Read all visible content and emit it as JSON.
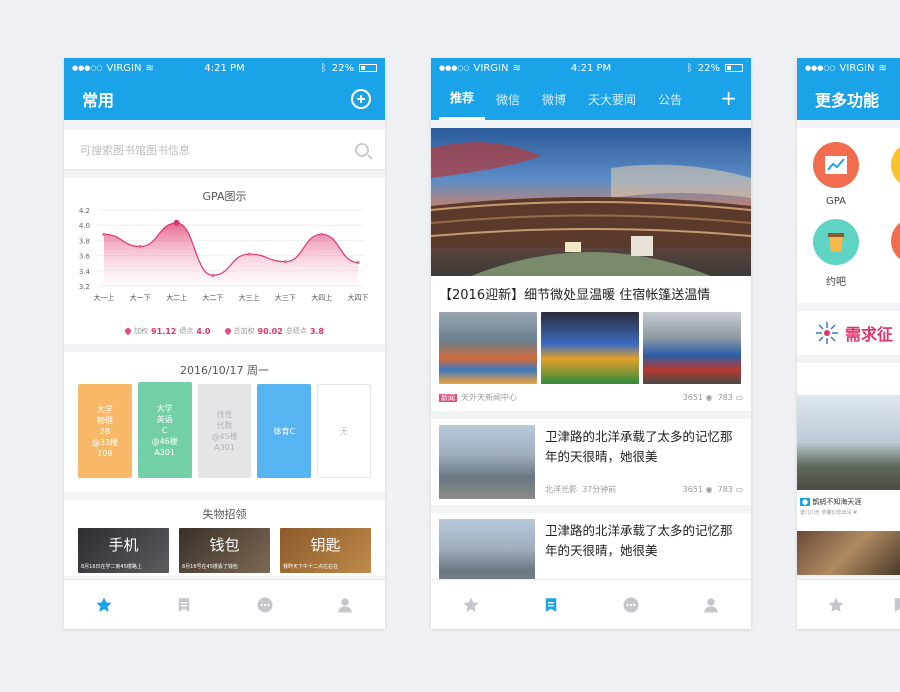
{
  "status": {
    "carrier": "VIRGIN",
    "time": "4:21 PM",
    "battery": "22%"
  },
  "screen1": {
    "title": "常用",
    "search_placeholder": "可搜索图书馆图书信息",
    "gpa": {
      "title": "GPA图示",
      "legend": [
        {
          "label": "加权",
          "value": "91.12"
        },
        {
          "label": "绩点",
          "value": "4.0"
        },
        {
          "label": "总加权",
          "value": "90.02"
        },
        {
          "label": "总绩点",
          "value": "3.8"
        }
      ]
    },
    "chart_data": {
      "type": "area",
      "title": "GPA图示",
      "categories": [
        "大一上",
        "大一下",
        "大二上",
        "大二下",
        "大三上",
        "大三下",
        "大四上",
        "大四下"
      ],
      "yticks": [
        "4.2",
        "4.0",
        "3.8",
        "3.6",
        "3.4",
        "3.2"
      ],
      "ylim": [
        3.2,
        4.2
      ],
      "series": [
        {
          "values": [
            3.88,
            3.72,
            4.03,
            3.34,
            3.62,
            3.52,
            3.88,
            3.51
          ]
        }
      ],
      "color": "#e0346c"
    },
    "calendar": {
      "date": "2016/10/17  周一",
      "blocks": [
        {
          "lines": [
            "大学",
            "物理",
            "2B",
            "@33楼",
            "109"
          ],
          "color": "#f7b968"
        },
        {
          "lines": [
            "大学",
            "英语",
            "C",
            "@46楼",
            "A301"
          ],
          "color": "#73cfa8"
        },
        {
          "lines": [
            "线性",
            "代数",
            "@45楼",
            "A301"
          ],
          "color": "#e4e5e7"
        },
        {
          "lines": [
            "体育C"
          ],
          "color": "#56b4f1"
        },
        {
          "lines": [
            "无"
          ],
          "color": "#ffffff"
        }
      ]
    },
    "lost": {
      "title": "失物招领",
      "items": [
        {
          "name": "手机",
          "desc": "8月16日在学二到45楼路上"
        },
        {
          "name": "钱包",
          "desc": "8月16号在45楼丢了钱包"
        },
        {
          "name": "钥匙",
          "desc": "我昨天下午十二点左右在"
        }
      ]
    }
  },
  "screen2": {
    "tabs": [
      "推荐",
      "微信",
      "微博",
      "天大要闻",
      "公告"
    ],
    "plus": "+",
    "featured": {
      "title": "【2016迎新】细节微处显温暖 住宿帐篷送温情",
      "tag": "新闻",
      "source": "天外天新闻中心",
      "views": "3651",
      "comments": "783"
    },
    "news": [
      {
        "title": "卫津路的北洋承载了太多的记忆那年的天很晴，她很美",
        "source": "北洋光影",
        "time": "37分钟前",
        "views": "3651",
        "comments": "783"
      },
      {
        "title": "卫津路的北洋承载了太多的记忆那年的天很晴，她很美",
        "source": "",
        "time": "",
        "views": "",
        "comments": ""
      }
    ]
  },
  "screen3": {
    "title": "更多功能",
    "icons": [
      {
        "label": "GPA",
        "color": "#f26c4f",
        "icon": "chart-icon"
      },
      {
        "label": "约吧",
        "color": "#5fd3c4",
        "icon": "cup-icon"
      }
    ],
    "demand": "需求征",
    "caption": "鹊鸫不知海天涯",
    "caption_sub": "波儿川乐 表勝幻影出没 #"
  }
}
